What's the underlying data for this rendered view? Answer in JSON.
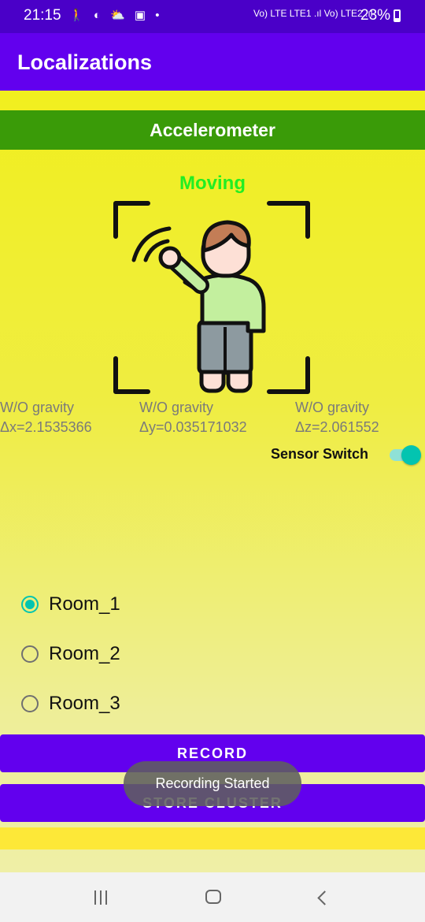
{
  "status_bar": {
    "time": "21:15",
    "notification_icons": "🚶 ◐ ⛅ ▣ •",
    "network": "Vo) LTE LTE1 .ıl Vo) LTE2 .ıl",
    "battery": "23%"
  },
  "app_bar": {
    "title": "Localizations"
  },
  "sensor_panel": {
    "header": "Accelerometer",
    "state": "Moving",
    "readings": [
      {
        "label": "W/O gravity",
        "value": "Δx=2.1535366"
      },
      {
        "label": "W/O gravity",
        "value": "Δy=0.035171032"
      },
      {
        "label": "W/O gravity",
        "value": "Δz=2.061552"
      }
    ],
    "switch_label": "Sensor Switch",
    "switch_on": true
  },
  "rooms": {
    "options": [
      "Room_1",
      "Room_2",
      "Room_3"
    ],
    "selected": "Room_1"
  },
  "buttons": {
    "record": "RECORD",
    "store_cluster": "STORE CLUSTER"
  },
  "toast": "Recording Started",
  "colors": {
    "status_bar": "#4a00c8",
    "app_bar": "#6200ee",
    "accelerometer_header": "#3a9b08",
    "moving_text": "#22ee22",
    "accent": "#03c4b0"
  },
  "icons": {
    "illustration": "person-waving-in-frame",
    "nav_recents": "recents-icon",
    "nav_home": "home-icon",
    "nav_back": "back-icon"
  }
}
